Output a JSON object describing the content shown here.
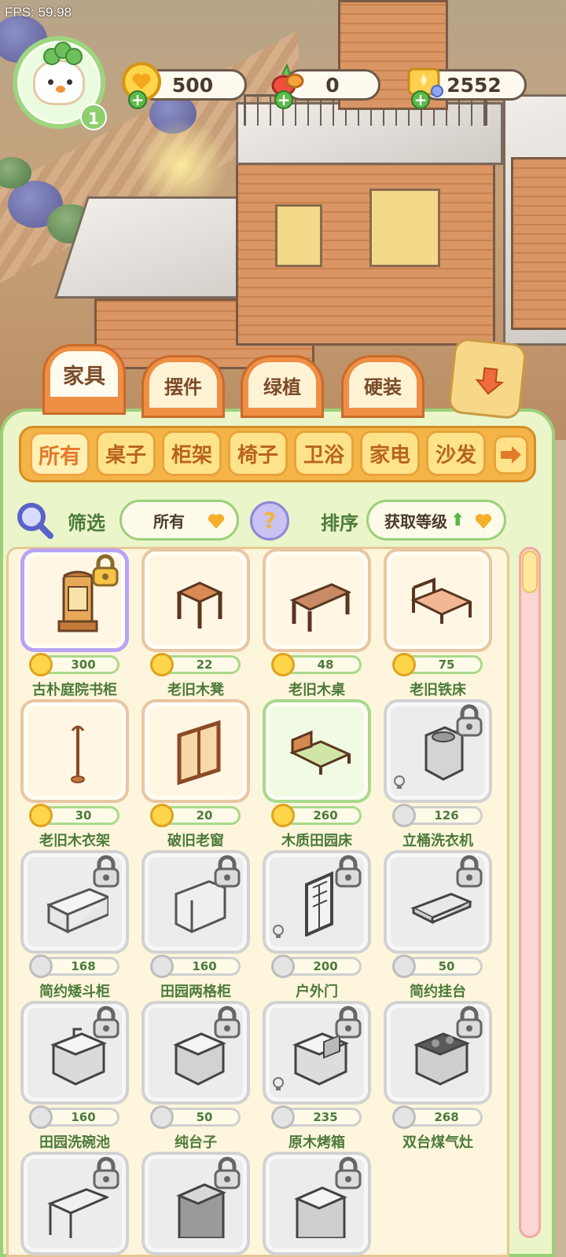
{
  "debug": {
    "fps_text": "FPS: 59.98"
  },
  "player": {
    "level": "1"
  },
  "currencies": [
    {
      "name": "coin",
      "value": "500",
      "icon": "coin-icon"
    },
    {
      "name": "produce",
      "value": "0",
      "icon": "vegetable-icon"
    },
    {
      "name": "ticket",
      "value": "2552",
      "icon": "ticket-icon"
    }
  ],
  "categories": [
    "家具",
    "摆件",
    "绿植",
    "硬装"
  ],
  "subcategories": [
    "所有",
    "桌子",
    "柜架",
    "椅子",
    "卫浴",
    "家电",
    "沙发"
  ],
  "filter": {
    "label": "筛选",
    "value": "所有"
  },
  "sort": {
    "label": "排序",
    "value": "获取等级"
  },
  "items": [
    {
      "price": "300",
      "name": "古朴庭院书柜",
      "state": "special",
      "locked": true
    },
    {
      "price": "22",
      "name": "老旧木凳",
      "state": "normal",
      "locked": false
    },
    {
      "price": "48",
      "name": "老旧木桌",
      "state": "normal",
      "locked": false
    },
    {
      "price": "75",
      "name": "老旧铁床",
      "state": "normal",
      "locked": false
    },
    {
      "price": "30",
      "name": "老旧木衣架",
      "state": "normal",
      "locked": false
    },
    {
      "price": "20",
      "name": "破旧老窗",
      "state": "normal",
      "locked": false
    },
    {
      "price": "260",
      "name": "木质田园床",
      "state": "green",
      "locked": false
    },
    {
      "price": "126",
      "name": "立桶洗衣机",
      "state": "locked",
      "locked": true
    },
    {
      "price": "168",
      "name": "简约矮斗柜",
      "state": "locked",
      "locked": true
    },
    {
      "price": "160",
      "name": "田园两格柜",
      "state": "locked",
      "locked": true
    },
    {
      "price": "200",
      "name": "户外门",
      "state": "locked",
      "locked": true
    },
    {
      "price": "50",
      "name": "简约挂台",
      "state": "locked",
      "locked": true
    },
    {
      "price": "160",
      "name": "田园洗碗池",
      "state": "locked",
      "locked": true
    },
    {
      "price": "50",
      "name": "纯台子",
      "state": "locked",
      "locked": true
    },
    {
      "price": "235",
      "name": "原木烤箱",
      "state": "locked",
      "locked": true
    },
    {
      "price": "268",
      "name": "双台煤气灶",
      "state": "locked",
      "locked": true
    },
    {
      "price": "",
      "name": "",
      "state": "locked",
      "locked": true
    },
    {
      "price": "",
      "name": "",
      "state": "locked",
      "locked": true
    },
    {
      "price": "",
      "name": "",
      "state": "locked",
      "locked": true
    }
  ],
  "colors": {
    "panel": "#eaf5c9",
    "accent_green": "#9ccf7a",
    "tab_orange": "#ee8f45",
    "subtab_yellow": "#f4b447"
  }
}
